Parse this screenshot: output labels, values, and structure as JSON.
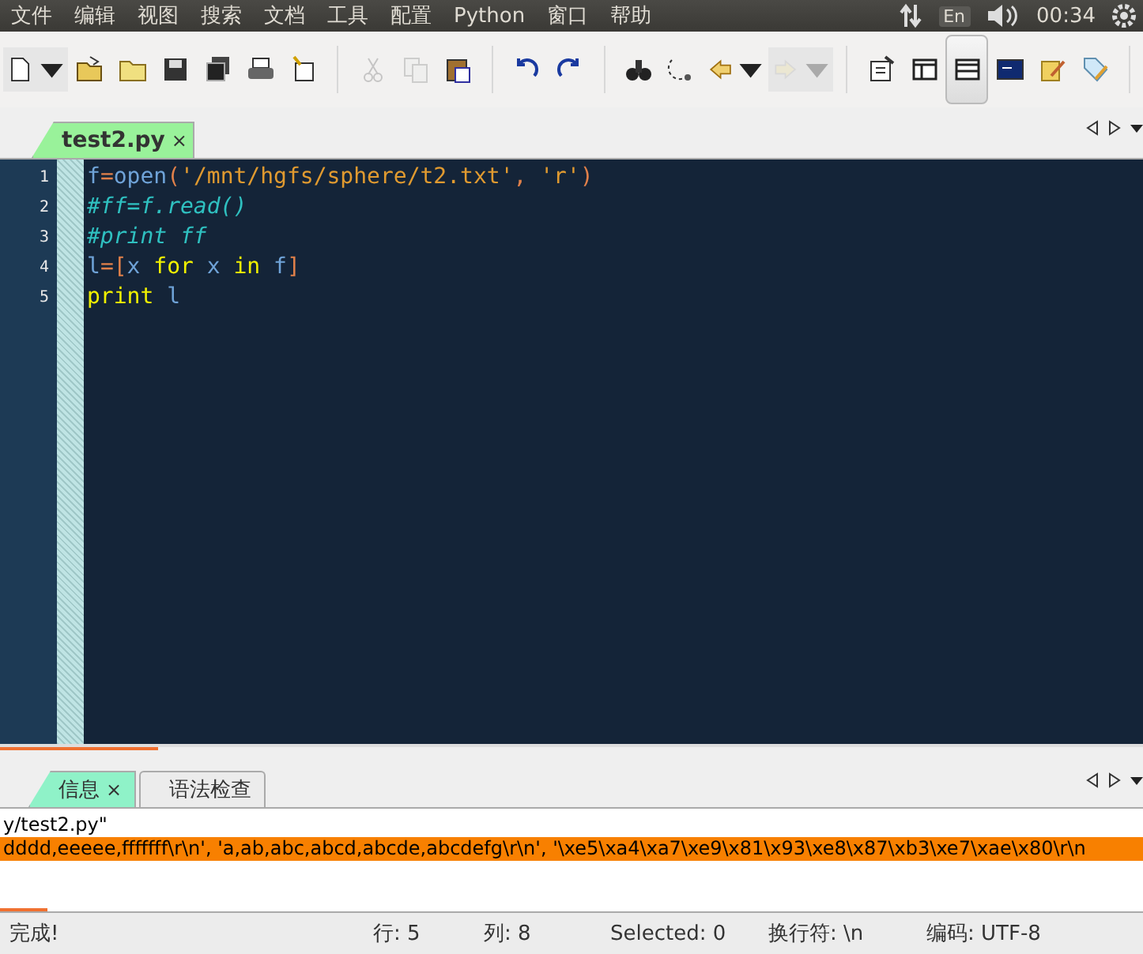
{
  "menu_bar": {
    "items": [
      "文件",
      "编辑",
      "视图",
      "搜索",
      "文档",
      "工具",
      "配置",
      "Python",
      "窗口",
      "帮助"
    ],
    "indicators": {
      "keyboard": "En",
      "clock": "00:34"
    }
  },
  "toolbar": {
    "buttons": [
      {
        "kind": "new",
        "disabled": false
      },
      {
        "kind": "open",
        "disabled": false
      },
      {
        "kind": "folder",
        "disabled": false
      },
      {
        "kind": "save",
        "disabled": false
      },
      {
        "kind": "save-all",
        "disabled": false
      },
      {
        "kind": "print",
        "disabled": false
      },
      {
        "kind": "edit",
        "disabled": false
      },
      {
        "kind": "cut",
        "disabled": true
      },
      {
        "kind": "copy",
        "disabled": true
      },
      {
        "kind": "paste",
        "disabled": false
      },
      {
        "kind": "undo",
        "disabled": false
      },
      {
        "kind": "redo",
        "disabled": false
      },
      {
        "kind": "find",
        "disabled": false
      },
      {
        "kind": "replace",
        "disabled": false
      },
      {
        "kind": "back",
        "disabled": false
      },
      {
        "kind": "forward",
        "disabled": true
      },
      {
        "kind": "prefs",
        "disabled": false
      },
      {
        "kind": "sidebar",
        "disabled": false
      },
      {
        "kind": "panel",
        "disabled": false,
        "selected": true
      },
      {
        "kind": "python",
        "disabled": false
      },
      {
        "kind": "note",
        "disabled": false
      },
      {
        "kind": "tag",
        "disabled": false
      }
    ]
  },
  "editor_tabs": [
    {
      "label": "test2.py",
      "close": "×",
      "selected": true
    }
  ],
  "editor": {
    "lines": [
      {
        "number": "1",
        "tokens": [
          {
            "kind": "name",
            "text": "f"
          },
          {
            "kind": "op",
            "text": "="
          },
          {
            "kind": "name",
            "text": "open"
          },
          {
            "kind": "op",
            "text": "("
          },
          {
            "kind": "string",
            "text": "'/mnt/hgfs/sphere/t2.txt'"
          },
          {
            "kind": "op",
            "text": ","
          },
          {
            "kind": "string",
            "text": " 'r'"
          },
          {
            "kind": "op",
            "text": ")"
          }
        ]
      },
      {
        "number": "2",
        "tokens": [
          {
            "kind": "comment",
            "text": "#ff=f.read()"
          }
        ]
      },
      {
        "number": "3",
        "tokens": [
          {
            "kind": "comment",
            "text": "#print ff"
          }
        ]
      },
      {
        "number": "4",
        "tokens": [
          {
            "kind": "name",
            "text": "l"
          },
          {
            "kind": "op",
            "text": "=["
          },
          {
            "kind": "name",
            "text": "x"
          },
          {
            "kind": "keyword",
            "text": " for"
          },
          {
            "kind": "name",
            "text": " x"
          },
          {
            "kind": "keyword",
            "text": " in"
          },
          {
            "kind": "name",
            "text": " f"
          },
          {
            "kind": "op",
            "text": "]"
          }
        ]
      },
      {
        "number": "5",
        "tokens": [
          {
            "kind": "keyword",
            "text": "print"
          },
          {
            "kind": "name",
            "text": " l"
          }
        ]
      }
    ]
  },
  "panel_tabs": [
    {
      "label": "信息",
      "close": "×",
      "selected": true
    },
    {
      "label": "语法检查",
      "selected": false
    }
  ],
  "output": {
    "lines": [
      {
        "text": "y/test2.py\"",
        "highlighted": false
      },
      {
        "text": "dddd,eeeee,fffffff\\r\\n', 'a,ab,abc,abcd,abcde,abcdefg\\r\\n', '\\xe5\\xa4\\xa7\\xe9\\x81\\x93\\xe8\\x87\\xb3\\xe7\\xae\\x80\\r\\n",
        "highlighted": true
      }
    ]
  },
  "status_bar": {
    "message": "完成!",
    "line": "行: 5",
    "column": "列: 8",
    "selected": "Selected: 0",
    "line_ending": "换行符: \\n",
    "encoding": "编码: UTF-8"
  }
}
